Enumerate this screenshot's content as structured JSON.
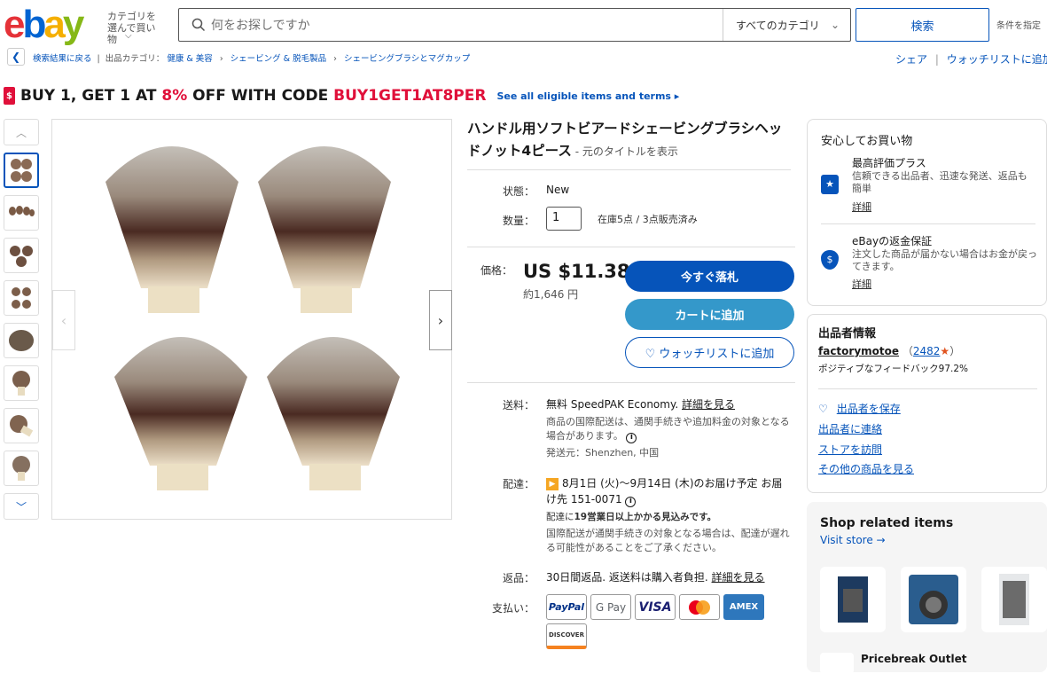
{
  "header": {
    "logo": [
      "e",
      "b",
      "a",
      "y"
    ],
    "shop_by_category": "カテゴリを選んで買い物",
    "search_placeholder": "何をお探しですか",
    "category_select": "すべてのカテゴリ",
    "search_button": "検索",
    "advanced": "条件を指定"
  },
  "breadcrumb": {
    "back": "検索結果に戻る",
    "sep1": "|",
    "listed_in": "出品カテゴリ：",
    "items": [
      "健康 & 美容",
      "シェービング & 脱毛製品",
      "シェービングブラシとマグカップ"
    ]
  },
  "share": {
    "share": "シェア",
    "sep": "|",
    "watchlist": "ウォッチリストに追加"
  },
  "promo": {
    "icon": "$",
    "pre": "BUY 1, GET 1 AT ",
    "pct": "8%",
    "mid": " OFF WITH CODE ",
    "code": "BUY1GET1AT8PER",
    "link": "See all eligible items and terms ▸"
  },
  "listing": {
    "title": "ハンドル用ソフトビアードシェービングブラシヘッドノット4ピース",
    "orig_title": "元のタイトルを表示",
    "orig_prefix": " - ",
    "condition_label": "状態：",
    "condition_value": "New",
    "qty_label": "数量：",
    "qty_value": "1",
    "stock": "在庫5点 / 3点販売済み",
    "price_label": "価格：",
    "price": "US $11.38",
    "price_local": "約1,646 円",
    "buy_now": "今すぐ落札",
    "add_cart": "カートに追加",
    "add_watch": "♡ ウォッチリストに追加"
  },
  "shipping": {
    "label": "送料：",
    "free": "無料",
    "method": " SpeedPAK Economy. ",
    "details": "詳細を見る",
    "note": "商品の国際配送は、通関手続きや追加料金の対象となる場合があります。",
    "from": "発送元：Shenzhen, 中国"
  },
  "delivery": {
    "label": "配達：",
    "dates": "8月1日 (火)〜9月14日 (木)のお届け予定 お届け先 151-0071",
    "note_pre": "配達に",
    "note_bold": "19営業日以上かかる見込みです。",
    "note2": "国際配送が通関手続きの対象となる場合は、配達が遅れる可能性があることをご了承ください。"
  },
  "returns": {
    "label": "返品：",
    "text": "30日間返品. 返送料は購入者負担. ",
    "details": "詳細を見る"
  },
  "payments": {
    "label": "支払い：",
    "methods": [
      "PayPal",
      "G Pay",
      "VISA",
      "",
      "AMEX",
      "DISCOVER"
    ]
  },
  "trust": {
    "heading": "安心してお買い物",
    "items": [
      {
        "title": "最高評価プラス",
        "desc": "信頼できる出品者、迅速な発送、返品も簡単",
        "link": "詳細"
      },
      {
        "title": "eBayの返金保証",
        "desc": "注文した商品が届かない場合はお金が戻ってきます。",
        "link": "詳細"
      }
    ]
  },
  "seller": {
    "heading": "出品者情報",
    "name": "factorymotoe",
    "score": "2482",
    "feedback": "ポジティブなフィードバック97.2%",
    "links": [
      "出品者を保存",
      "出品者に連絡",
      "ストアを訪問",
      "その他の商品を見る"
    ]
  },
  "related": {
    "heading": "Shop related items",
    "visit": "Visit store →",
    "store_name": "Pricebreak Outlet"
  },
  "colors": {
    "ebay_red": "#e53238",
    "ebay_blue": "#0064d2",
    "ebay_yellow": "#f5af02",
    "ebay_green": "#86b817",
    "link": "#0654ba",
    "promo_red": "#e0103a"
  }
}
